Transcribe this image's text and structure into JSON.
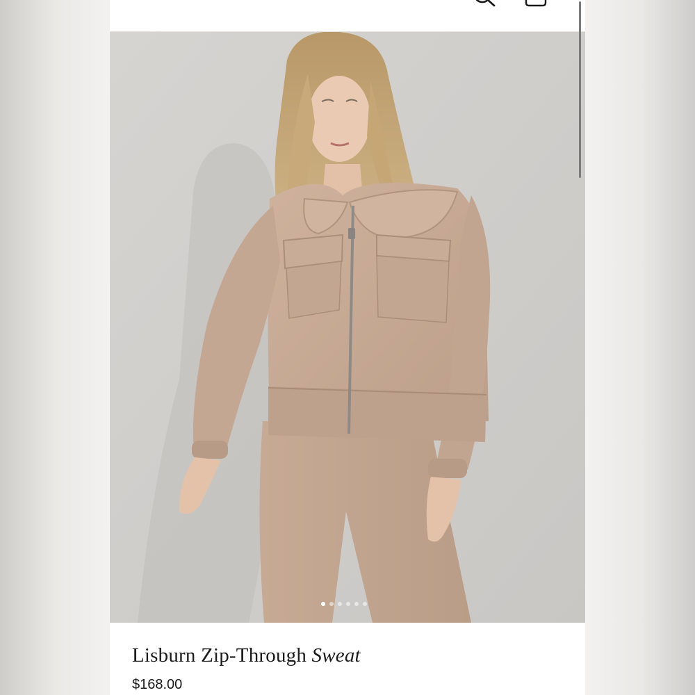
{
  "header": {
    "menu_icon": "hamburger-menu-icon",
    "search_icon": "search-icon",
    "bag_icon": "shopping-bag-icon"
  },
  "product": {
    "image_alt": "Model wearing beige collared zip-through jacket with flap pockets and matching joggers",
    "title_main": "Lisburn Zip-Through",
    "title_italic": "Sweat",
    "price": "$168.00"
  },
  "carousel": {
    "dot_count": 6,
    "active_index": 0
  },
  "colors": {
    "background_side": "#efeeec",
    "screen": "#ffffff",
    "photo_bg": "#cdcbc8",
    "garment": "#c8ab95",
    "text": "#1a1a1a"
  }
}
